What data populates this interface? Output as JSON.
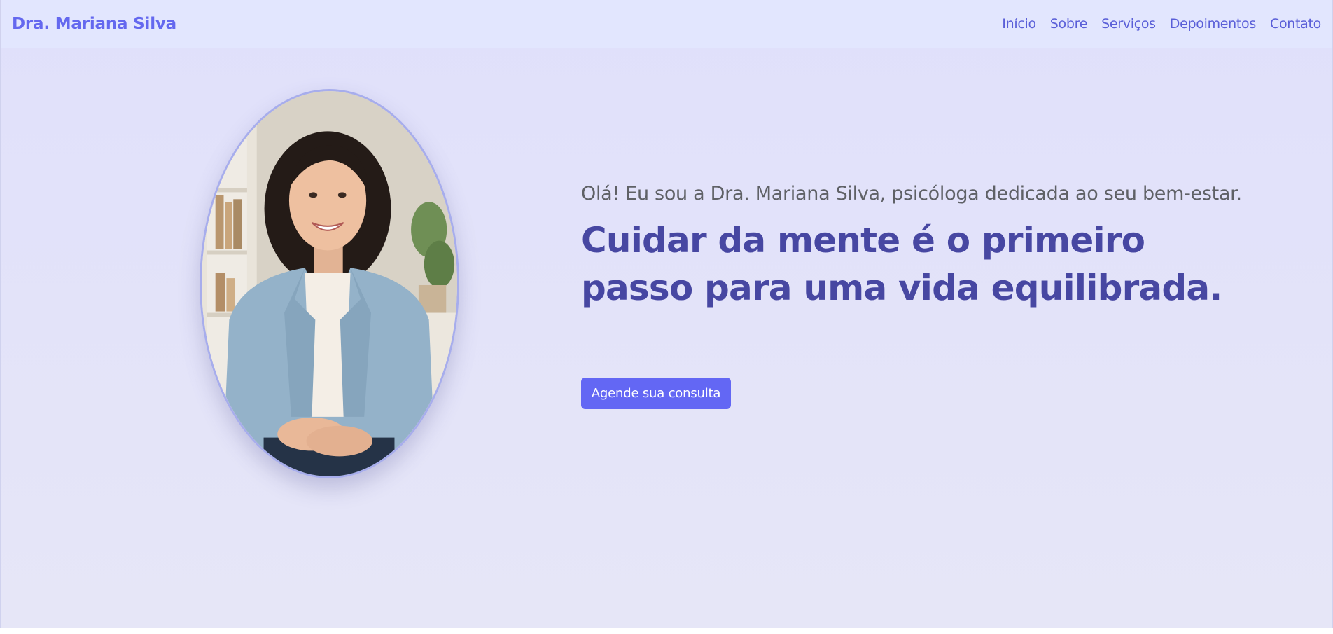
{
  "navbar": {
    "brand": "Dra. Mariana Silva",
    "links": [
      {
        "label": "Início"
      },
      {
        "label": "Sobre"
      },
      {
        "label": "Serviços"
      },
      {
        "label": "Depoimentos"
      },
      {
        "label": "Contato"
      }
    ]
  },
  "hero": {
    "greeting": "Olá! Eu sou a Dra. Mariana Silva, psicóloga dedicada ao seu bem-estar.",
    "headline": "Cuidar da mente é o primeiro passo para uma vida equilibrada.",
    "cta_label": "Agende sua consulta"
  },
  "colors": {
    "brand": "#6468ef",
    "nav_link": "#5a5fd8",
    "headline": "#4747a2",
    "cta_background": "#6367f4",
    "page_background": "#e2e2f9"
  }
}
